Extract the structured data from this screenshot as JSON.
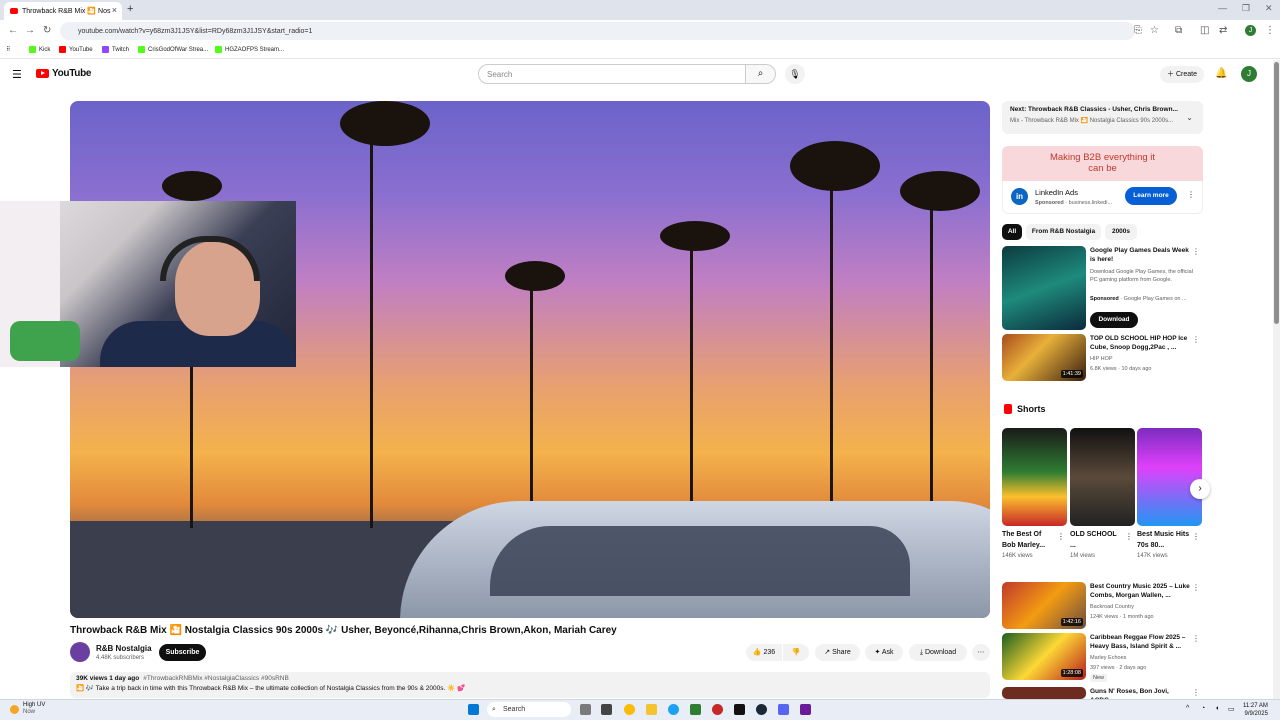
{
  "browser": {
    "tab_title": "Throwback R&B Mix 🎦 Nos",
    "url": "youtube.com/watch?v=y68zm3J1JSY&list=RDy68zm3J1JSY&start_radio=1",
    "bookmarks": [
      {
        "label": "Kick",
        "color": "#53fc18"
      },
      {
        "label": "YouTube",
        "color": "#ff0000"
      },
      {
        "label": "Twitch",
        "color": "#9146ff"
      },
      {
        "label": "CrisGodOfWar Strea...",
        "color": "#53fc18"
      },
      {
        "label": "HGZAOFPS Stream...",
        "color": "#53fc18"
      }
    ]
  },
  "yt": {
    "logo_text": "YouTube",
    "search_placeholder": "Search",
    "create_label": "Create",
    "avatar_initial": "J"
  },
  "video": {
    "title": "Throwback R&B Mix 🎦 Nostalgia Classics 90s 2000s 🎶 Usher, Beyoncé,Rihanna,Chris Brown,Akon, Mariah Carey",
    "channel": "R&B Nostalgia",
    "subscribers": "4.48K subscribers",
    "subscribe_label": "Subscribe",
    "likes": "236",
    "share_label": "Share",
    "ask_label": "Ask",
    "download_label": "Download",
    "views_date": "39K views  1 day ago",
    "hashtags": "#ThrowbackRNBMix #NostalgiaClassics #90sRNB",
    "description": "🎦 🎶 Take a trip back in time with this Throwback R&B Mix – the ultimate collection of Nostalgia Classics from the 90s & 2000s. ☀️ 💕"
  },
  "sidebar": {
    "next_label": "Next: Throwback R&B Classics - Usher, Chris Brown...",
    "next_sub": "Mix - Throwback R&B Mix 🎦 Nostalgia Classics 90s 2000s...",
    "ad_banner": "Making B2B everything it can be",
    "ad_name": "LinkedIn Ads",
    "ad_sponsored": "Sponsored",
    "ad_domain": "· business.linkedi...",
    "ad_button": "Learn more",
    "chips": [
      "All",
      "From R&B Nostalgia",
      "2000s"
    ],
    "promo": {
      "title": "Google Play Games Deals Week is here!",
      "desc": "Download Google Play Games, the official PC gaming platform from Google.",
      "sponsored": "Sponsored",
      "sponsor_src": "· Google Play Games on ...",
      "button": "Download"
    },
    "rec1": {
      "title": "TOP OLD SCHOOL HIP HOP Ice Cube, Snoop Dogg,2Pac , ...",
      "channel": "HIP HOP",
      "meta": "6.8K views · 10 days ago",
      "duration": "1:41:39"
    },
    "shorts_title": "Shorts",
    "shorts": [
      {
        "title": "The Best Of Bob Marley...",
        "views": "146K views"
      },
      {
        "title": "OLD SCHOOL ...",
        "views": "1M views"
      },
      {
        "title": "Best Music Hits 70s 80...",
        "views": "147K views"
      }
    ],
    "rec2": {
      "title": "Best Country Music 2025 – Luke Combs, Morgan Wallen, ...",
      "channel": "Backroad Country",
      "meta": "124K views · 1 month ago",
      "duration": "1:42:16"
    },
    "rec3": {
      "title": "Caribbean Reggae Flow 2025 – Heavy Bass, Island Spirit & ...",
      "channel": "Marley Echoes",
      "meta": "397 views · 2 days ago",
      "badge": "New",
      "duration": "1:28:08"
    },
    "rec4": {
      "title": "Guns N' Roses, Bon Jovi, ACDC,"
    }
  },
  "taskbar": {
    "weather_main": "High UV",
    "weather_sub": "Now",
    "search": "Search",
    "time": "11:27 AM",
    "date": "9/9/2025"
  }
}
